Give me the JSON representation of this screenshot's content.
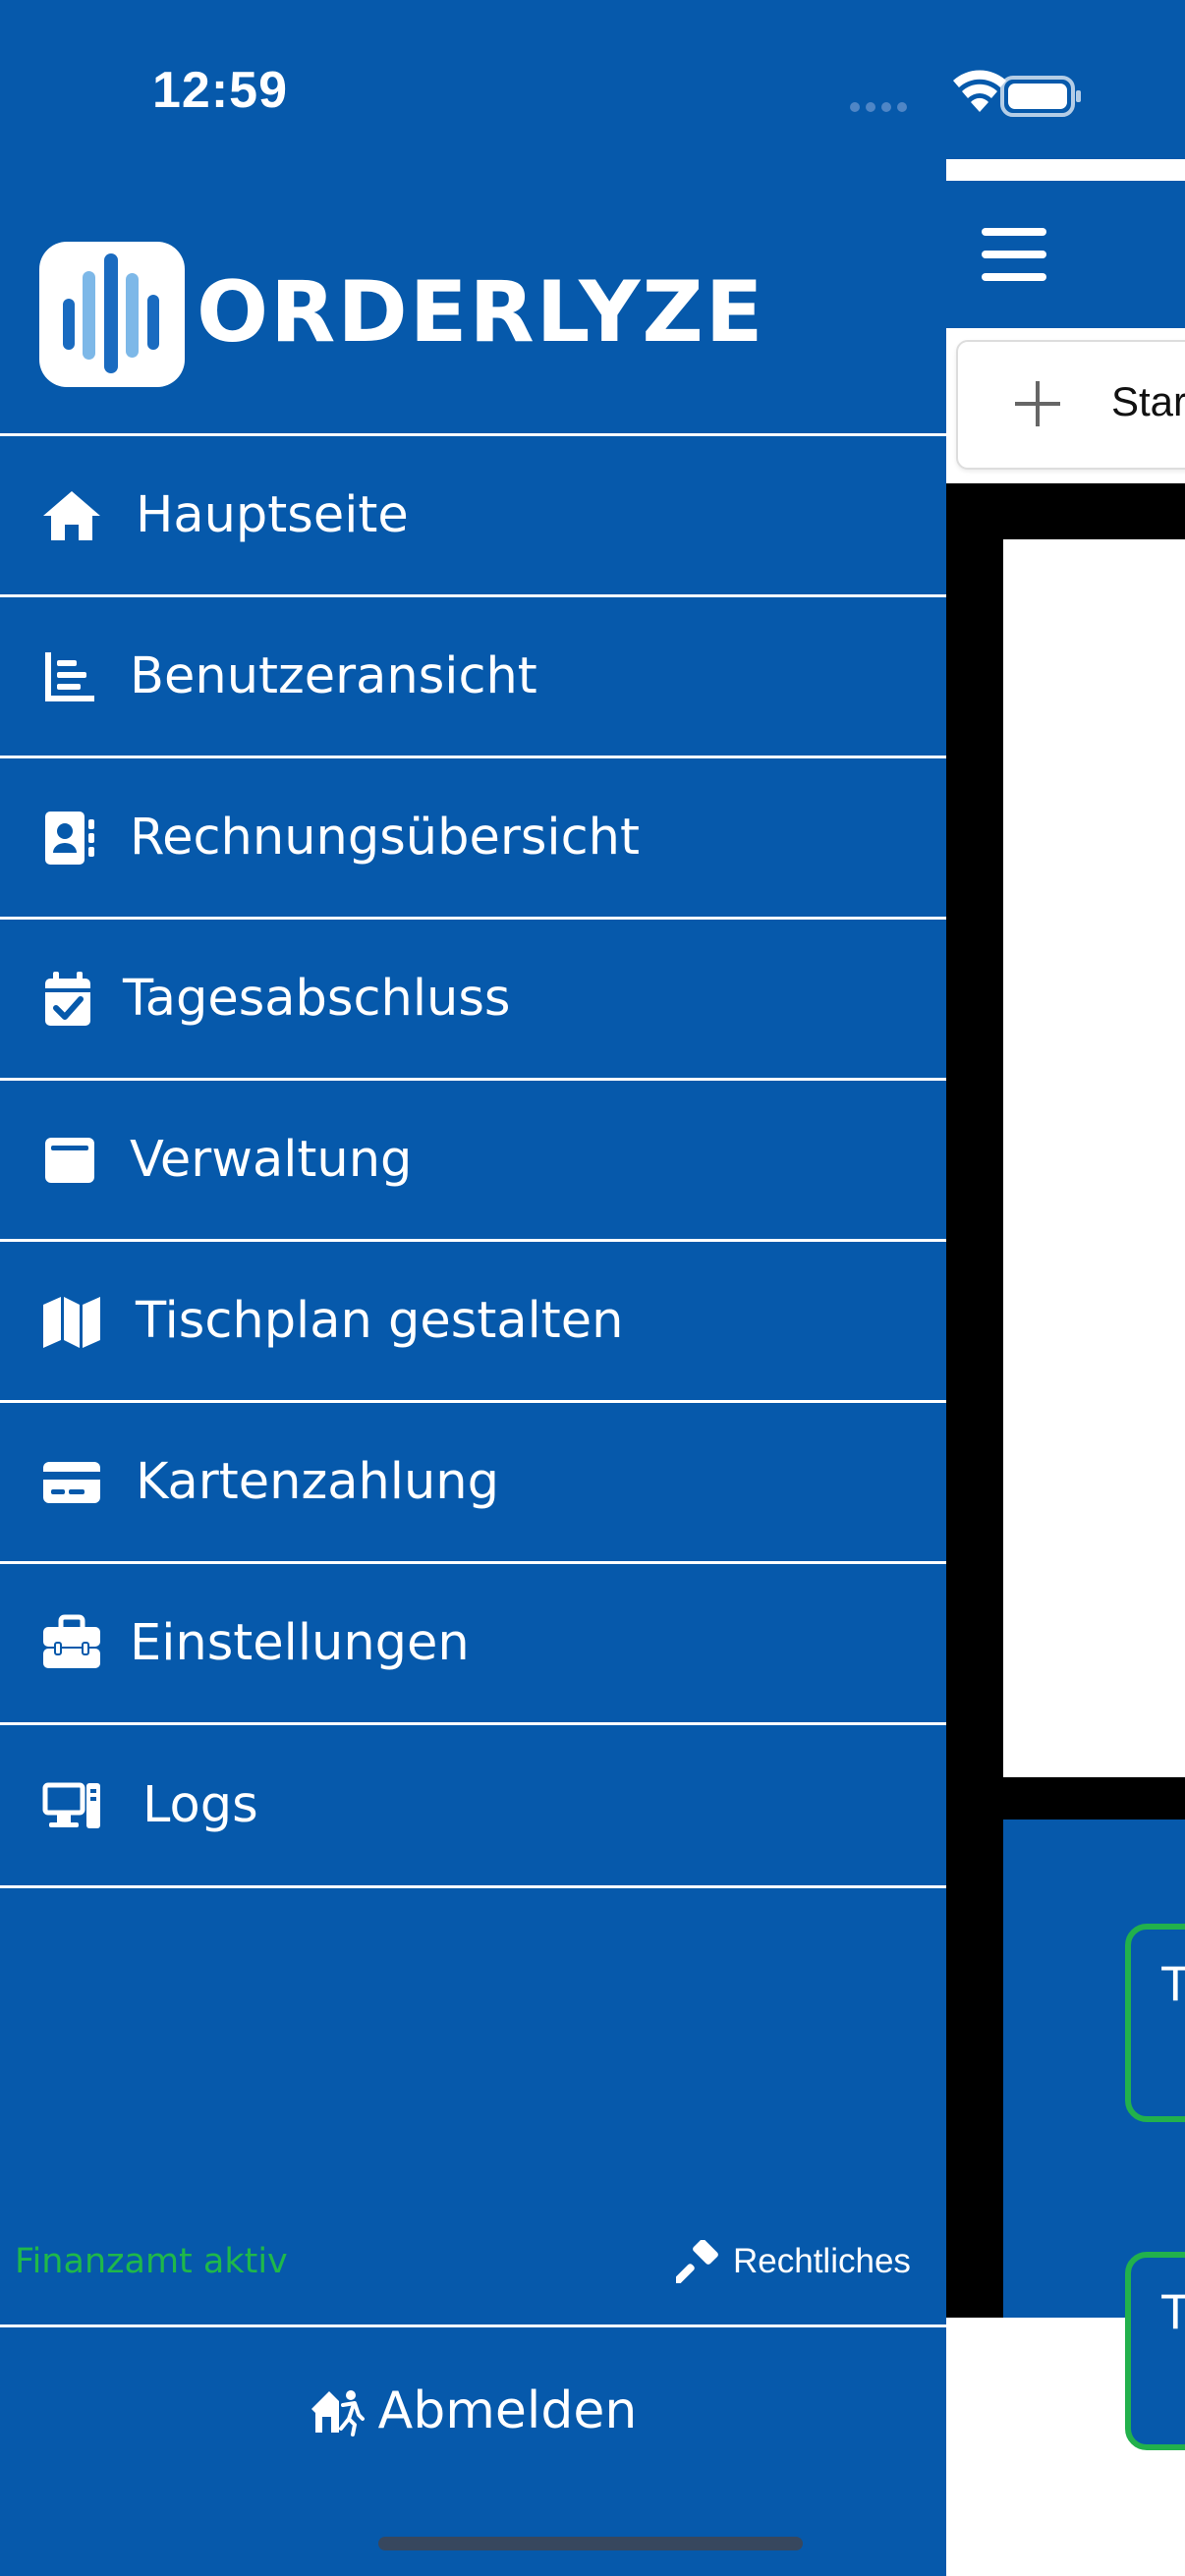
{
  "status_bar": {
    "time": "12:59"
  },
  "brand": {
    "name": "ORDERLYZE",
    "logo_colors": [
      "#1A6BC0",
      "#7DB8E8"
    ]
  },
  "sidebar": {
    "items": [
      {
        "label": "Hauptseite",
        "icon": "home-icon"
      },
      {
        "label": "Benutzeransicht",
        "icon": "chart-icon"
      },
      {
        "label": "Rechnungsübersicht",
        "icon": "address-book-icon"
      },
      {
        "label": "Tagesabschluss",
        "icon": "calendar-check-icon"
      },
      {
        "label": "Verwaltung",
        "icon": "window-icon"
      },
      {
        "label": "Tischplan gestalten",
        "icon": "map-icon"
      },
      {
        "label": "Kartenzahlung",
        "icon": "credit-card-icon"
      },
      {
        "label": "Einstellungen",
        "icon": "toolbox-icon"
      },
      {
        "label": "Logs",
        "icon": "computer-icon"
      }
    ]
  },
  "footer": {
    "status": "Finanzamt aktiv",
    "legal_label": "Rechtliches",
    "logout_label": "Abmelden"
  },
  "main": {
    "add_button_label": "Star",
    "tables": [
      "T",
      "T"
    ]
  },
  "colors": {
    "primary": "#0659AB",
    "status_green": "#1FB84A",
    "table_border": "#22B14C"
  }
}
